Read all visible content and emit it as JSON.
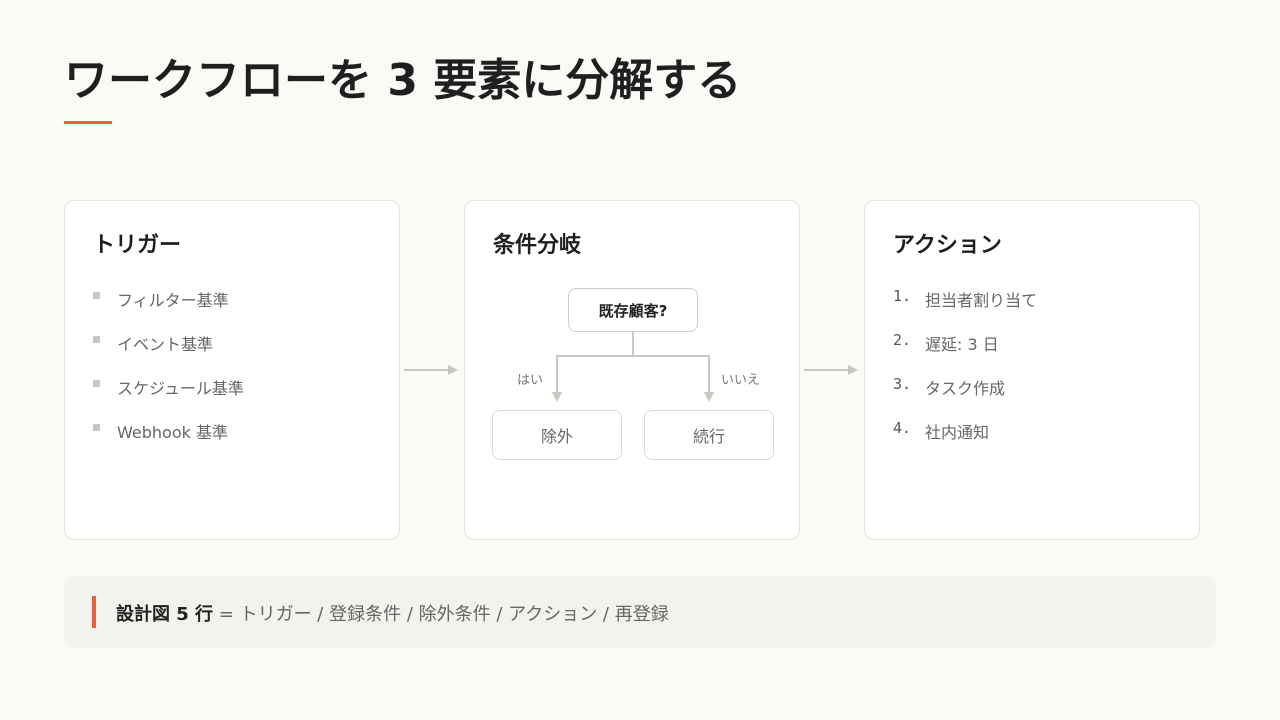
{
  "title": "ワークフローを 3 要素に分解する",
  "colors": {
    "accent": "#e8603c",
    "background": "#fafaf6",
    "card": "#ffffff",
    "connector": "#c8c8c0"
  },
  "trigger": {
    "title": "トリガー",
    "items": [
      "フィルター基準",
      "イベント基準",
      "スケジュール基準",
      "Webhook 基準"
    ]
  },
  "condition": {
    "title": "条件分岐",
    "question": "既存顧客?",
    "yes_label": "はい",
    "no_label": "いいえ",
    "yes_result": "除外",
    "no_result": "続行"
  },
  "action": {
    "title": "アクション",
    "items": [
      {
        "num": "1.",
        "label": "担当者割り当て"
      },
      {
        "num": "2.",
        "label": "遅延: 3 日"
      },
      {
        "num": "3.",
        "label": "タスク作成"
      },
      {
        "num": "4.",
        "label": "社内通知"
      }
    ]
  },
  "summary": {
    "strong": "設計図 5 行",
    "rest": " = トリガー / 登録条件 / 除外条件 / アクション / 再登録"
  }
}
